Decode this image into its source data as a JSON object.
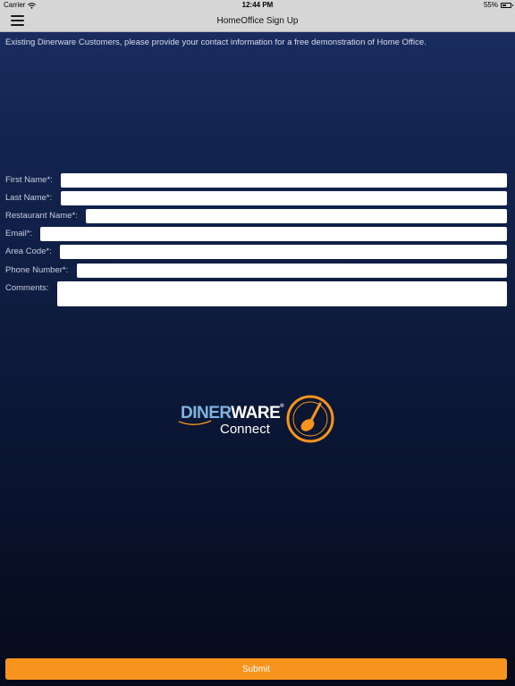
{
  "status_bar": {
    "carrier": "Carrier",
    "time": "12:44 PM",
    "battery_percent": "55%",
    "battery_level": 0.55
  },
  "nav": {
    "title": "HomeOffice Sign Up",
    "menu_icon": "hamburger-menu-icon"
  },
  "intro_text": "Existing Dinerware Customers, please provide your contact information for a free demonstration of Home Office.",
  "form": {
    "fields": [
      {
        "label": "First Name*:",
        "value": "",
        "placeholder": ""
      },
      {
        "label": "Last Name*:",
        "value": "",
        "placeholder": ""
      },
      {
        "label": "Restaurant Name*:",
        "value": "",
        "placeholder": ""
      },
      {
        "label": "Email*:",
        "value": "",
        "placeholder": ""
      },
      {
        "label": "Area Code*:",
        "value": "",
        "placeholder": ""
      },
      {
        "label": "Phone Number*:",
        "value": "",
        "placeholder": ""
      }
    ],
    "comments": {
      "label": "Comments:",
      "value": "",
      "placeholder": ""
    }
  },
  "logo": {
    "brand_part1": "DINER",
    "brand_part2": "WARE",
    "subtitle": "Connect",
    "emblem_icon": "spoon-emblem-icon"
  },
  "submit": {
    "label": "Submit"
  },
  "colors": {
    "accent": "#f7941d",
    "background_top": "#1c2f64",
    "background_bottom": "#050a18",
    "bar": "#d6d6d6",
    "logo_blue": "#7fb3e0"
  }
}
